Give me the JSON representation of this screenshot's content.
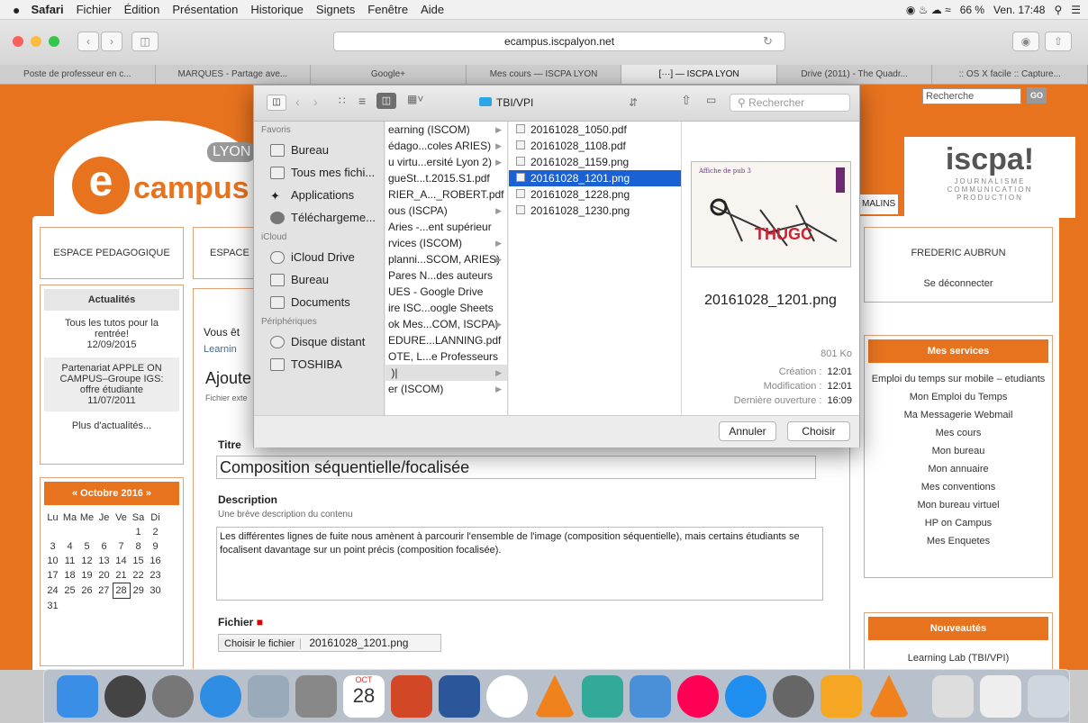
{
  "menubar": {
    "apple": "",
    "app": "Safari",
    "items": [
      "Fichier",
      "Édition",
      "Présentation",
      "Historique",
      "Signets",
      "Fenêtre",
      "Aide"
    ],
    "battery": "66 %",
    "clock": "Ven. 17:48"
  },
  "browser": {
    "url": "ecampus.iscpalyon.net",
    "tabs": [
      "Poste de professeur en c...",
      "MARQUES - Partage ave...",
      "Google+",
      "Mes cours — ISCPA LYON",
      "[···] — ISCPA LYON",
      "Drive (2011) - The Quadr...",
      ":: OS X facile :: Capture..."
    ]
  },
  "site": {
    "logo_text": "campus",
    "logo_city": "LYON",
    "nav": [
      "ESPACE PEDAGOGIQUE",
      "ESPACE A"
    ],
    "search_placeholder": "Recherche",
    "search_button": "GO",
    "iscpa_logo": "iscpa!",
    "iscpa_tag": [
      "JOURNALISME",
      "COMMUNICATION",
      "PRODUCTION"
    ],
    "malins": "MALINS",
    "actualites": {
      "title": "Actualités",
      "items": [
        {
          "text": "Tous les tutos pour la rentrée!",
          "date": "12/09/2015"
        },
        {
          "text": "Partenariat APPLE ON CAMPUS–Groupe IGS: offre étudiante",
          "date": "11/07/2011"
        }
      ],
      "more": "Plus d'actualités..."
    },
    "calendar": {
      "title": "« Octobre 2016 »",
      "days": [
        "Lu",
        "Ma",
        "Me",
        "Je",
        "Ve",
        "Sa",
        "Di"
      ],
      "weeks": [
        [
          "",
          "",
          "",
          "",
          "",
          "1",
          "2"
        ],
        [
          "3",
          "4",
          "5",
          "6",
          "7",
          "8",
          "9"
        ],
        [
          "10",
          "11",
          "12",
          "13",
          "14",
          "15",
          "16"
        ],
        [
          "17",
          "18",
          "19",
          "20",
          "21",
          "22",
          "23"
        ],
        [
          "24",
          "25",
          "26",
          "27",
          "28",
          "29",
          "30"
        ],
        [
          "31",
          "",
          "",
          "",
          "",
          "",
          ""
        ]
      ],
      "today": "28"
    },
    "user": {
      "name": "FREDERIC AUBRUN",
      "logout": "Se déconnecter"
    },
    "services": {
      "title": "Mes services",
      "items": [
        "Emploi du temps sur mobile – etudiants",
        "Mon Emploi du Temps",
        "Ma Messagerie Webmail",
        "Mes cours",
        "Mon bureau",
        "Mon annuaire",
        "Mes conventions",
        "Mon bureau virtuel",
        "HP on Campus",
        "Mes Enquetes"
      ]
    },
    "nouveautes": {
      "title": "Nouveautés",
      "items": [
        "Learning Lab (TBI/VPI)"
      ]
    },
    "form": {
      "crumb1": "Vous êt",
      "crumb2": "Learnin",
      "heading": "Ajoute",
      "ext": "Fichier exte",
      "title_label": "Titre",
      "title_value": "Composition séquentielle/focalisée",
      "desc_label": "Description",
      "desc_hint": "Une brève description du contenu",
      "desc_value": "Les différentes lignes de fuite nous amènent à parcourir l'ensemble de l'image (composition séquentielle), mais certains étudiants se focalisent davantage sur un point précis (composition focalisée).",
      "file_label": "Fichier",
      "file_button": "Choisir le fichier",
      "file_name": "20161028_1201.png"
    }
  },
  "dialog": {
    "folder": "TBI/VPI",
    "search_placeholder": "Rechercher",
    "sidebar": {
      "favoris_header": "Favoris",
      "favoris": [
        "Bureau",
        "Tous mes fichi...",
        "Applications",
        "Téléchargeme..."
      ],
      "icloud_header": "iCloud",
      "icloud": [
        "iCloud Drive",
        "Bureau",
        "Documents"
      ],
      "peripheriques_header": "Périphériques",
      "peripheriques": [
        "Disque distant",
        "TOSHIBA"
      ]
    },
    "col1": [
      "earning (ISCOM)",
      "édago...coles ARIES)",
      "u virtu...ersité Lyon 2)",
      "gueSt...t.2015.S1.pdf",
      "RIER_A..._ROBERT.pdf",
      "ous (ISCPA)",
      "Aries -...ent supérieur",
      "rvices (ISCOM)",
      "planni...SCOM, ARIES)",
      "Pares N...des auteurs",
      "UES - Google Drive",
      "ire ISC...oogle Sheets",
      "ok Mes...COM, ISCPA)",
      "EDURE...LANNING.pdf",
      "OTE, L...e Professeurs",
      " )|",
      "er (ISCOM)"
    ],
    "col2": [
      "20161028_1050.pdf",
      "20161028_1108.pdf",
      "20161028_1159.png",
      "20161028_1201.png",
      "20161028_1228.png",
      "20161028_1230.png"
    ],
    "preview": {
      "thumb_caption": "Affiche de pub 3",
      "thumb_word": "THUGC",
      "filename": "20161028_1201.png",
      "size": "801 Ko",
      "meta": [
        {
          "label": "Création :",
          "value": "12:01"
        },
        {
          "label": "Modification :",
          "value": "12:01"
        },
        {
          "label": "Dernière ouverture :",
          "value": "16:09"
        }
      ]
    },
    "cancel": "Annuler",
    "choose": "Choisir"
  },
  "dock": {
    "calendar_day": "28",
    "calendar_month": "OCT"
  }
}
